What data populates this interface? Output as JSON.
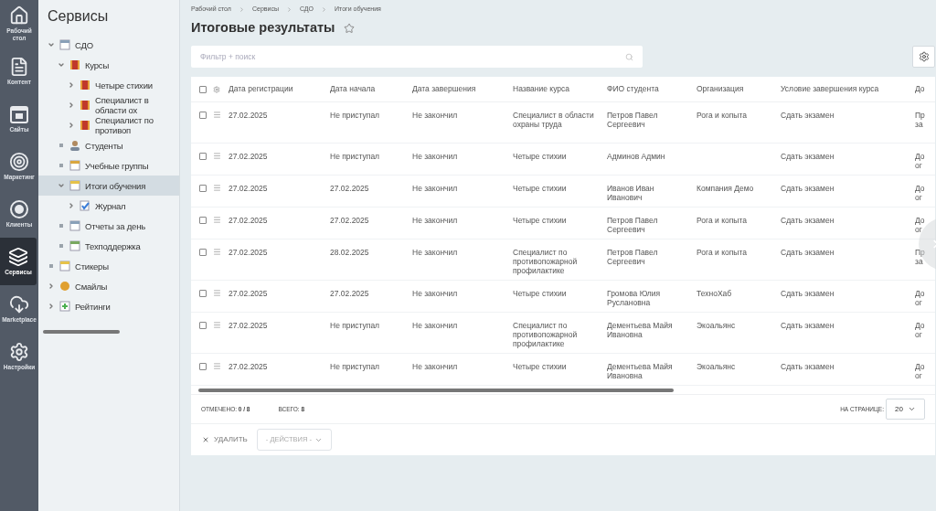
{
  "nav": [
    {
      "label": "Рабочий стол",
      "selected": false
    },
    {
      "label": "Контент",
      "selected": false
    },
    {
      "label": "Сайты",
      "selected": false
    },
    {
      "label": "Маркетинг",
      "selected": false
    },
    {
      "label": "Клиенты",
      "selected": false
    },
    {
      "label": "Сервисы",
      "selected": true
    },
    {
      "label": "Marketplace",
      "selected": false
    },
    {
      "label": "Настройки",
      "selected": false
    }
  ],
  "tree": {
    "title": "Сервисы",
    "items": [
      {
        "label": "СДО",
        "kind": "branch",
        "expanded": true,
        "selected": false,
        "children": [
          {
            "label": "Курсы",
            "kind": "branch",
            "expanded": true,
            "selected": false,
            "children": [
              {
                "label": "Четыре стихии",
                "kind": "branch",
                "expanded": false,
                "selected": false
              },
              {
                "label": "Специалист в области ох",
                "kind": "branch",
                "expanded": false,
                "selected": false
              },
              {
                "label": "Специалист по противоп",
                "kind": "branch",
                "expanded": false,
                "selected": false
              }
            ]
          },
          {
            "label": "Студенты",
            "kind": "leaf",
            "selected": false
          },
          {
            "label": "Учебные группы",
            "kind": "leaf",
            "selected": false
          },
          {
            "label": "Итоги обучения",
            "kind": "branch",
            "expanded": true,
            "selected": true,
            "children": [
              {
                "label": "Журнал",
                "kind": "branch",
                "expanded": false,
                "selected": false
              }
            ]
          },
          {
            "label": "Отчеты за день",
            "kind": "leaf",
            "selected": false
          },
          {
            "label": "Техподдержка",
            "kind": "leaf",
            "selected": false
          }
        ]
      },
      {
        "label": "Стикеры",
        "kind": "leaf",
        "selected": false
      },
      {
        "label": "Смайлы",
        "kind": "branch",
        "expanded": false,
        "selected": false
      },
      {
        "label": "Рейтинги",
        "kind": "branch",
        "expanded": false,
        "selected": false
      }
    ]
  },
  "breadcrumbs": [
    "Рабочий стол",
    "Сервисы",
    "СДО",
    "Итоги обучения"
  ],
  "title": "Итоговые результаты",
  "search": {
    "placeholder": "Фильтр + поиск"
  },
  "table": {
    "all_checked": false,
    "columns": [
      "Дата регистрации",
      "Дата начала",
      "Дата завершения",
      "Название курса",
      "ФИО студента",
      "Организация",
      "Условие завершения курса",
      "До"
    ],
    "rows": [
      {
        "checked": false,
        "cells": [
          "27.02.2025",
          "Не приступал",
          "Не закончил",
          "Специалист в области охраны труда",
          "Петров Павел Сергеевич",
          "Рога и копыта",
          "Сдать экзамен",
          "Пр за"
        ]
      },
      {
        "checked": false,
        "cells": [
          "27.02.2025",
          "Не приступал",
          "Не закончил",
          "Четыре стихии",
          "Админов Админ",
          "",
          "Сдать экзамен",
          "До ог"
        ]
      },
      {
        "checked": false,
        "cells": [
          "27.02.2025",
          "27.02.2025",
          "Не закончил",
          "Четыре стихии",
          "Иванов Иван Иванович",
          "Компания Демо",
          "Сдать экзамен",
          "До ог"
        ]
      },
      {
        "checked": false,
        "cells": [
          "27.02.2025",
          "27.02.2025",
          "Не закончил",
          "Четыре стихии",
          "Петров Павел Сергеевич",
          "Рога и копыта",
          "Сдать экзамен",
          "До ог"
        ]
      },
      {
        "checked": false,
        "cells": [
          "27.02.2025",
          "28.02.2025",
          "Не закончил",
          "Специалист по противопожарной профилактике",
          "Петров Павел Сергеевич",
          "Рога и копыта",
          "Сдать экзамен",
          "Пр за"
        ]
      },
      {
        "checked": false,
        "cells": [
          "27.02.2025",
          "27.02.2025",
          "Не закончил",
          "Четыре стихии",
          "Громова Юлия Руслановна",
          "ТехноХаб",
          "Сдать экзамен",
          "До ог"
        ]
      },
      {
        "checked": false,
        "cells": [
          "27.02.2025",
          "Не приступал",
          "Не закончил",
          "Специалист по противопожарной профилактике",
          "Дементьева Майя Ивановна",
          "Экоальянс",
          "Сдать экзамен",
          "До ог"
        ]
      },
      {
        "checked": false,
        "cells": [
          "27.02.2025",
          "Не приступал",
          "Не закончил",
          "Четыре стихии",
          "Дементьева Майя Ивановна",
          "Экоальянс",
          "Сдать экзамен",
          "До ог"
        ]
      }
    ]
  },
  "footer": {
    "checked_label": "ОТМЕЧЕНО:",
    "checked_value": "0 / 8",
    "total_label": "ВСЕГО:",
    "total_value": "8",
    "per_page_label": "НА СТРАНИЦЕ:",
    "per_page": "20"
  },
  "actions": {
    "delete": "УДАЛИТЬ",
    "actions_placeholder": "- ДЕЙСТВИЯ -"
  }
}
